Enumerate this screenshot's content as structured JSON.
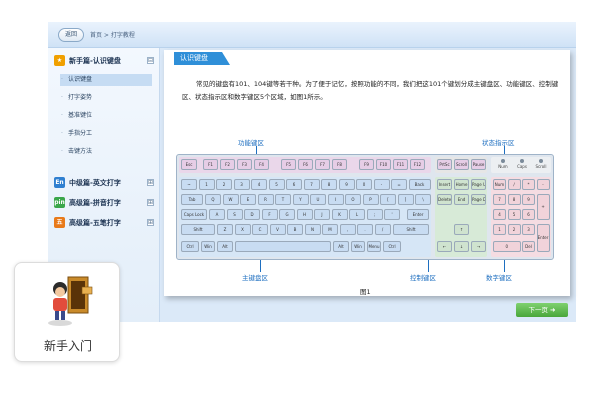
{
  "topbar": {
    "back_label": "返回",
    "breadcrumb": "首页 > 打字教程"
  },
  "sidebar": {
    "sections": [
      {
        "label": "新手篇-认识键盘",
        "icon": "lightbulb-icon",
        "icon_color": "#f0a000",
        "icon_text": "★",
        "toggle": "⊟"
      },
      {
        "label": "中级篇-英文打字",
        "icon": "en-icon",
        "icon_color": "#2f7fd0",
        "icon_text": "En",
        "toggle": "⊞"
      },
      {
        "label": "高级篇-拼音打字",
        "icon": "pin-icon",
        "icon_color": "#3aa64a",
        "icon_text": "pin",
        "toggle": "⊞"
      },
      {
        "label": "高级篇-五笔打字",
        "icon": "wubi-icon",
        "icon_color": "#e87a1a",
        "icon_text": "五",
        "toggle": "⊞"
      }
    ],
    "sub_items": [
      "认识键盘",
      "打字姿势",
      "基准键位",
      "手指分工",
      "击键方法"
    ],
    "active_sub": "认识键盘"
  },
  "content": {
    "tab_label": "认识键盘",
    "description": "常见的键盘有101、104键等若干种。为了便于记忆，按照功能的不同，我们把这101个键划分成主键盘区、功能键区、控制键区、状态指示区和数字键区5个区域，如图1所示。",
    "callouts": {
      "function": "功能键区",
      "status": "状态指示区",
      "main": "主键盘区",
      "control": "控制键区",
      "numeric": "数字键区"
    },
    "figure_caption": "图1",
    "next_label": "下一页 ➜"
  },
  "keyboard": {
    "function_row": [
      "Esc",
      "F1",
      "F2",
      "F3",
      "F4",
      "F5",
      "F6",
      "F7",
      "F8",
      "F9",
      "F10",
      "F11",
      "F12"
    ],
    "sys_keys": [
      "PrtSc",
      "Scroll",
      "Pause"
    ],
    "status_lights": [
      "Num",
      "Caps",
      "Scroll"
    ],
    "row1": [
      "~",
      "1",
      "2",
      "3",
      "4",
      "5",
      "6",
      "7",
      "8",
      "9",
      "0",
      "-",
      "=",
      "Back"
    ],
    "row2": [
      "Tab",
      "Q",
      "W",
      "E",
      "R",
      "T",
      "Y",
      "U",
      "I",
      "O",
      "P",
      "[",
      "]",
      "\\"
    ],
    "row3": [
      "Caps Lock",
      "A",
      "S",
      "D",
      "F",
      "G",
      "H",
      "J",
      "K",
      "L",
      ";",
      "'",
      "Enter"
    ],
    "row4": [
      "Shift",
      "Z",
      "X",
      "C",
      "V",
      "B",
      "N",
      "M",
      ",",
      ".",
      "/",
      "Shift"
    ],
    "row5": [
      "Ctrl",
      "Win",
      "Alt",
      "",
      "Alt",
      "Win",
      "Menu",
      "Ctrl"
    ],
    "control_keys": [
      "Insert",
      "Home",
      "Page Up",
      "Delete",
      "End",
      "Page Down"
    ],
    "arrows": [
      "↑",
      "←",
      "↓",
      "→"
    ],
    "numpad": [
      "Num",
      "/",
      "*",
      "-",
      "7",
      "8",
      "9",
      "+",
      "4",
      "5",
      "6",
      "1",
      "2",
      "3",
      "Enter",
      "0",
      "Del"
    ]
  },
  "popup": {
    "label": "新手入门",
    "icon": "beginner-door-icon"
  }
}
